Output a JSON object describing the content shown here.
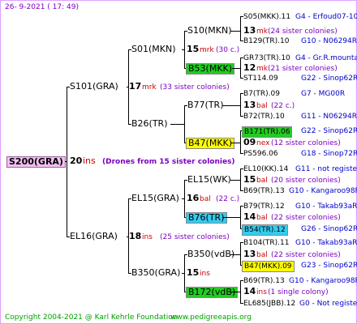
{
  "header": "26-  9-2021 ( 17: 49)",
  "footer": {
    "copyright": "Copyright 2004-2021 @ Karl Kehrle Foundation",
    "site": "www.pedigreeapis.org"
  },
  "root": {
    "name": "S200(GRA)",
    "num": "20",
    "suffix": "ins",
    "note": "(Drones from 15 sister colonies)"
  },
  "g1": [
    {
      "name": "S101(GRA)",
      "num": "17",
      "suffix": "mrk",
      "note": "(33 sister colonies)"
    },
    {
      "name": "EL16(GRA)",
      "num": "18",
      "suffix": "ins",
      "note": "(25 sister colonies)"
    }
  ],
  "g2": [
    {
      "name": "S01(MKN)"
    },
    {
      "name": "B26(TR)"
    },
    {
      "name": "EL15(GRA)",
      "num": "16",
      "suffix": "bal",
      "note": "(22 c.)"
    },
    {
      "name": "B350(GRA)",
      "num": "15",
      "suffix": "ins"
    }
  ],
  "g3": [
    {
      "name": "S10(MKN)",
      "num": "15",
      "suffix": "mrk",
      "note": "(30 c.)"
    },
    {
      "name": "B53(MKK)"
    },
    {
      "name": "B77(TR)"
    },
    {
      "name": "B47(MKK)"
    },
    {
      "name": "EL15(WK)"
    },
    {
      "name": "B76(TR)"
    },
    {
      "name": "B350(vdB)"
    },
    {
      "name": "B172(vdB)"
    }
  ],
  "g3info": [
    {
      "num": "13",
      "suffix": "mk",
      "note": "(24 sister colonies)"
    },
    {
      "num": "12",
      "suffix": "mk",
      "note": "(21 sister colonies)"
    },
    {
      "num": "13",
      "suffix": "bal",
      "note": "(22 c.)"
    },
    {
      "num": "09",
      "suffix": "nex",
      "note": "(12 sister colonies)"
    },
    {
      "num": "15",
      "suffix": "bal",
      "note": "(20 sister colonies)"
    },
    {
      "num": "14",
      "suffix": "bal",
      "note": "(22 sister colonies)"
    },
    {
      "num": "13",
      "suffix": "bal",
      "note": "(22 sister colonies)"
    },
    {
      "num": "14",
      "suffix": "ins",
      "note": "(1 single colony)"
    }
  ],
  "g4": [
    {
      "name": "S05(MKK).11",
      "code": "G4 - Erfoud07-10"
    },
    {
      "name": "B129(TR).10",
      "code": "G10 - N06294R"
    },
    {
      "name": "GR73(TR).10",
      "code": "G4 - Gr.R.mounta"
    },
    {
      "name": "ST114.09",
      "code": "G22 - Sinop62R"
    },
    {
      "name": "B7(TR).09",
      "code": "G7 - MG00R"
    },
    {
      "name": "B72(TR).10",
      "code": "G11 - N06294R"
    },
    {
      "name": "B171(TR).06",
      "code": "G22 - Sinop62R"
    },
    {
      "name": "PS596.06",
      "code": "G18 - Sinop72R"
    },
    {
      "name": "EL10(KK).14",
      "code": "G11 - not registe"
    },
    {
      "name": "B69(TR).13",
      "code": "G10 - Kangaroo98R"
    },
    {
      "name": "B79(TR).12",
      "code": "G10 - Takab93aR"
    },
    {
      "name": "B54(TR).12",
      "code": "G26 - Sinop62R"
    },
    {
      "name": "B104(TR).11",
      "code": "G10 - Takab93aR"
    },
    {
      "name": "B47(MKK).09",
      "code": "G23 - Sinop62R"
    },
    {
      "name": "B69(TR).13",
      "code": "G10 - Kangaroo98R"
    },
    {
      "name": "EL685(JBB).12",
      "code": "G0 - Not registe"
    }
  ],
  "colors": {
    "green": "#22cc22",
    "yellow": "#ffff00",
    "cyan": "#33ccee",
    "rootbg": "#f0c0f0"
  }
}
